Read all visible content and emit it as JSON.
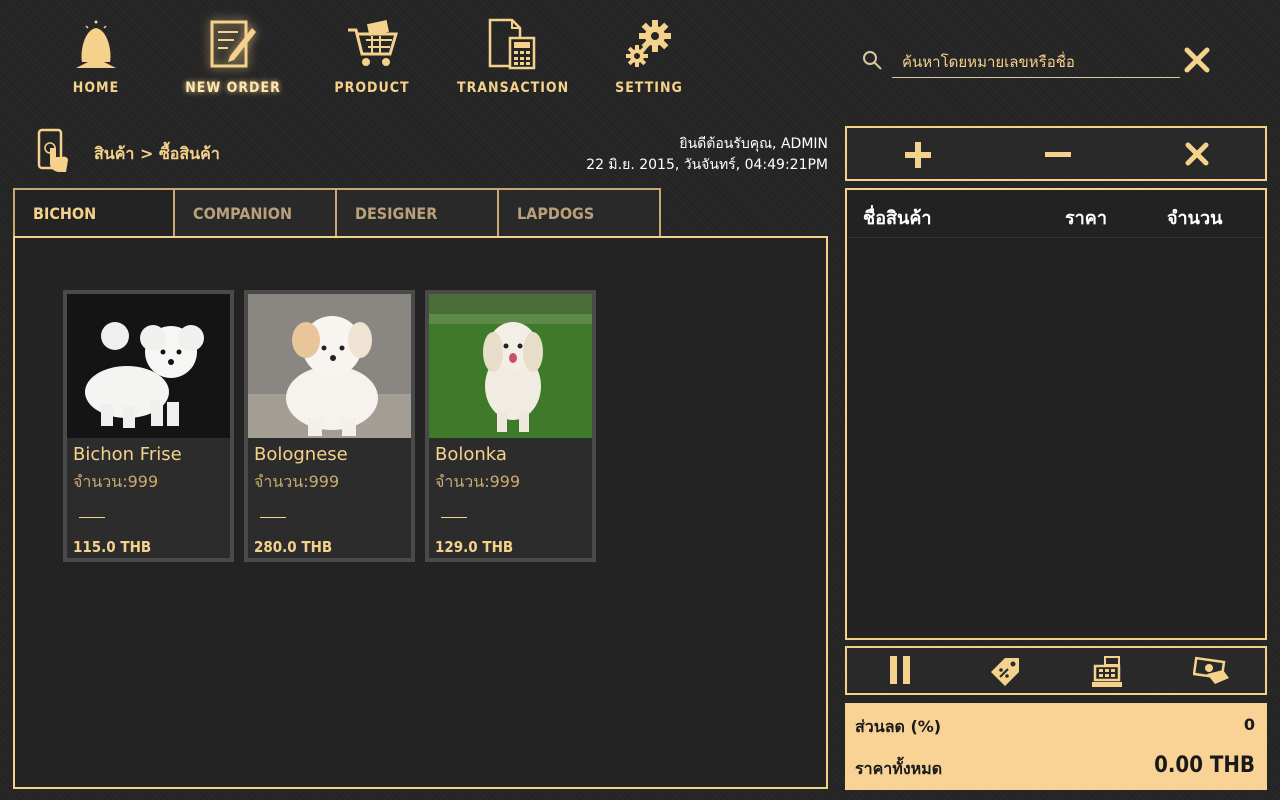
{
  "nav": {
    "items": [
      {
        "label": "HOME",
        "icon": "home-icon"
      },
      {
        "label": "NEW ORDER",
        "icon": "new-order-icon"
      },
      {
        "label": "PRODUCT",
        "icon": "cart-icon"
      },
      {
        "label": "TRANSACTION",
        "icon": "transaction-icon"
      },
      {
        "label": "SETTING",
        "icon": "gear-icon"
      }
    ],
    "active": "NEW ORDER"
  },
  "search": {
    "placeholder": "ค้นหาโดยหมายเลขหรือชื่อ",
    "value": ""
  },
  "header": {
    "breadcrumb": "สินค้า > ซื้อสินค้า",
    "welcome": "ยินดีต้อนรับคุณ, ADMIN",
    "datetime": "22 มิ.ย. 2015, วันจันทร์, 04:49:21PM"
  },
  "tabs": [
    {
      "label": "BICHON",
      "active": true
    },
    {
      "label": "COMPANION",
      "active": false
    },
    {
      "label": "DESIGNER",
      "active": false
    },
    {
      "label": "LAPDOGS",
      "active": false
    }
  ],
  "products": [
    {
      "name": "Bichon Frise",
      "stock": "จำนวน:999",
      "price": "115.0 THB",
      "photo_bg": "#111111"
    },
    {
      "name": "Bolognese",
      "stock": "จำนวน:999",
      "price": "280.0 THB",
      "photo_bg": "#7d7a76"
    },
    {
      "name": "Bolonka",
      "stock": "จำนวน:999",
      "price": "129.0 THB",
      "photo_bg": "#3f7a2a"
    }
  ],
  "order": {
    "columns": [
      "ชื่อสินค้า",
      "ราคา",
      "จำนวน"
    ],
    "rows": []
  },
  "actions": [
    "plus-icon",
    "minus-icon",
    "close-icon"
  ],
  "tools": [
    "pause-icon",
    "discount-tag-icon",
    "cash-register-icon",
    "cash-payment-icon"
  ],
  "summary": {
    "discount_label": "ส่วนลด (%)",
    "discount_value": "0",
    "total_label": "ราคาทั้งหมด",
    "total_value": "0.00 THB"
  },
  "colors": {
    "accent": "#f5d28c",
    "background": "#262525",
    "summary_bg": "#f8d395"
  }
}
